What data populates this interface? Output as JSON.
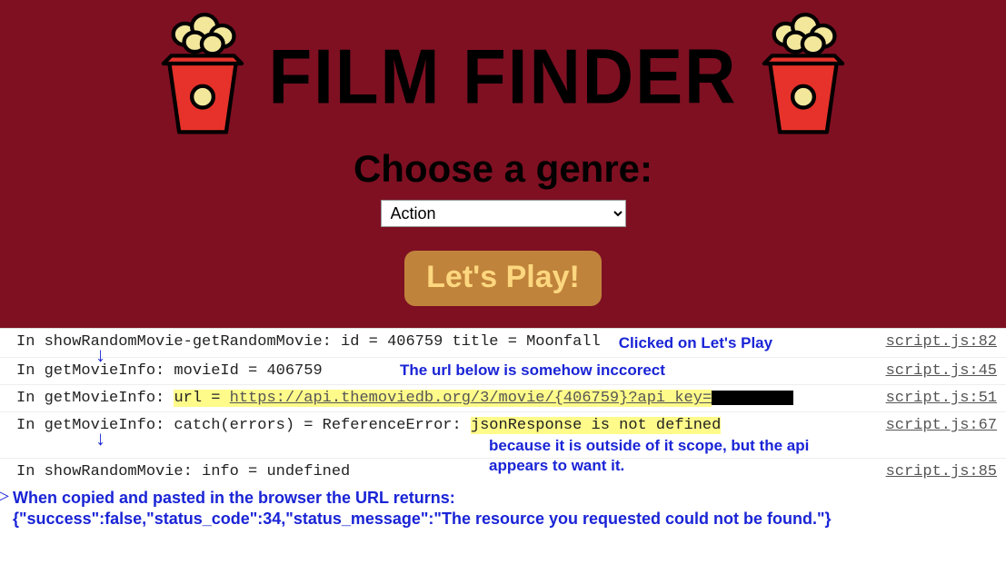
{
  "hero": {
    "title": "FILM FINDER",
    "subtitle": "Choose a genre:",
    "genre_selected": "Action",
    "play_label": "Let's Play!"
  },
  "icons": {
    "popcorn_left": "popcorn-icon",
    "popcorn_right": "popcorn-icon"
  },
  "console": {
    "rows": [
      {
        "text": "In showRandomMovie-getRandomMovie: id = 406759 title = Moonfall",
        "annotation": "Clicked on Let's Play",
        "source": "script.js:82"
      },
      {
        "text": "In getMovieInfo: movieId = 406759",
        "annotation": "The url below is somehow inccorect",
        "source": "script.js:45"
      },
      {
        "prefix": "In getMovieInfo: ",
        "hl_prefix": "url = ",
        "url": "https://api.themoviedb.org/3/movie/{406759}?api_key=",
        "redacted": true,
        "source": "script.js:51"
      },
      {
        "prefix": "In getMovieInfo: catch(errors) = ReferenceError: ",
        "hl_error": "jsonResponse is not defined",
        "annotation": "because it is outside of it scope, but the api appears to want it.",
        "source": "script.js:67"
      },
      {
        "text": "In showRandomMovie: info = undefined",
        "source": "script.js:85"
      }
    ],
    "footer_annot_1": "When copied and pasted in the browser the URL returns:",
    "footer_annot_2": "{\"success\":false,\"status_code\":34,\"status_message\":\"The resource you requested could not be found.\"}"
  }
}
